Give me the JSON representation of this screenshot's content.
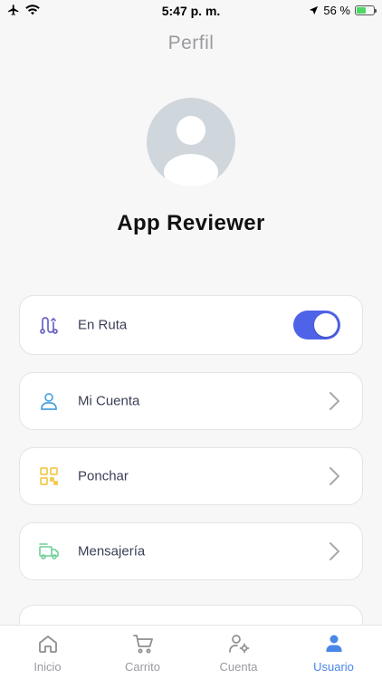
{
  "status_bar": {
    "time": "5:47 p. m.",
    "battery_text": "56 %",
    "battery_level": 0.56,
    "battery_color": "#4cd964",
    "icons": [
      "airplane-icon",
      "wifi-icon",
      "location-arrow-icon",
      "battery-icon"
    ]
  },
  "header": {
    "title": "Perfil"
  },
  "profile": {
    "name": "App Reviewer",
    "avatar_icon": "user-placeholder-icon"
  },
  "menu": {
    "items": [
      {
        "label": "En Ruta",
        "icon": "route-icon",
        "icon_color": "#6b63c9",
        "control": "toggle",
        "toggle_on": true
      },
      {
        "label": "Mi Cuenta",
        "icon": "user-icon",
        "icon_color": "#4aa3e0",
        "control": "chevron"
      },
      {
        "label": "Ponchar",
        "icon": "qr-code-icon",
        "icon_color": "#f2c94c",
        "control": "chevron"
      },
      {
        "label": "Mensajería",
        "icon": "delivery-truck-icon",
        "icon_color": "#6fcf97",
        "control": "chevron"
      }
    ]
  },
  "tab_bar": {
    "active": "Usuario",
    "active_color": "#4a86e8",
    "tabs": [
      {
        "label": "Inicio",
        "icon": "home-icon"
      },
      {
        "label": "Carrito",
        "icon": "cart-icon"
      },
      {
        "label": "Cuenta",
        "icon": "user-settings-icon"
      },
      {
        "label": "Usuario",
        "icon": "user-icon"
      }
    ]
  }
}
